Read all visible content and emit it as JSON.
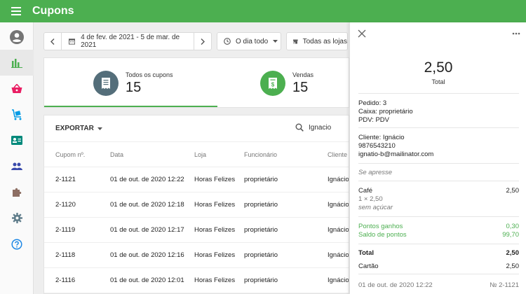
{
  "app": {
    "title": "Cupons"
  },
  "colors": {
    "accent": "#4caf50",
    "coupons_icon": "#546e7a",
    "sales_icon": "#4caf50"
  },
  "sidebar": {
    "items": [
      {
        "icon": "account-circle-icon"
      },
      {
        "icon": "bar-chart-icon"
      },
      {
        "icon": "basket-icon"
      },
      {
        "icon": "cart-icon"
      },
      {
        "icon": "id-card-icon"
      },
      {
        "icon": "people-icon"
      },
      {
        "icon": "puzzle-icon"
      },
      {
        "icon": "gear-icon"
      },
      {
        "icon": "help-icon"
      }
    ]
  },
  "filters": {
    "date_range": "4 de fev. de 2021 - 5 de mar. de 2021",
    "time": "O dia todo",
    "stores": "Todas as lojas"
  },
  "summary": {
    "coupons_label": "Todos os cupons",
    "coupons_value": "15",
    "sales_label": "Vendas",
    "sales_value": "15"
  },
  "table": {
    "export_label": "EXPORTAR",
    "search_value": "Ignacio",
    "columns": [
      "Cupom nº.",
      "Data",
      "Loja",
      "Funcionário",
      "Cliente"
    ],
    "rows": [
      [
        "2-1121",
        "01 de out. de 2020 12:22",
        "Horas Felizes",
        "proprietário",
        "Ignácio"
      ],
      [
        "2-1120",
        "01 de out. de 2020 12:18",
        "Horas Felizes",
        "proprietário",
        "Ignácio"
      ],
      [
        "2-1119",
        "01 de out. de 2020 12:17",
        "Horas Felizes",
        "proprietário",
        "Ignácio"
      ],
      [
        "2-1118",
        "01 de out. de 2020 12:16",
        "Horas Felizes",
        "proprietário",
        "Ignácio"
      ],
      [
        "2-1116",
        "01 de out. de 2020 12:01",
        "Horas Felizes",
        "proprietário",
        "Ignácio"
      ]
    ]
  },
  "panel": {
    "amount": "2,50",
    "amount_label": "Total",
    "order": "Pedido: 3",
    "cashier": "Caixa: proprietário",
    "pos": "PDV: PDV",
    "customer": "Cliente: Ignácio",
    "phone": "9876543210",
    "email": "ignatio-b@mailinator.com",
    "note": "Se apresse",
    "item_name": "Café",
    "item_price": "2,50",
    "item_qty": "1 × 2,50",
    "item_modifier": "sem açúcar",
    "points_earned_label": "Pontos ganhos",
    "points_earned_value": "0,30",
    "points_balance_label": "Saldo de pontos",
    "points_balance_value": "99,70",
    "total_label": "Total",
    "total_value": "2,50",
    "payment_label": "Cartão",
    "payment_value": "2,50",
    "footer_date": "01 de out. de 2020 12:22",
    "footer_number": "№ 2-1121"
  }
}
